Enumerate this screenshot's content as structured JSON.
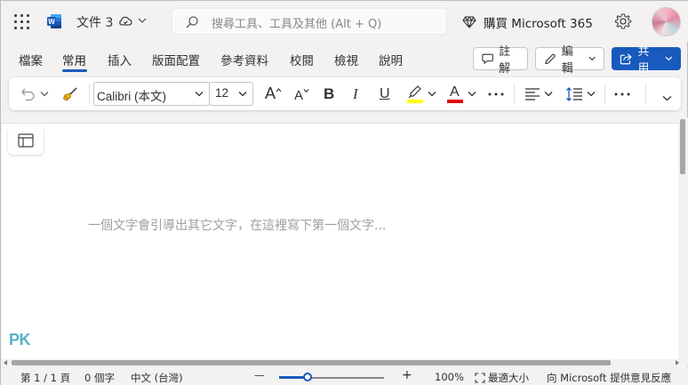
{
  "header": {
    "doc_title": "文件 3",
    "search_placeholder": "搜尋工具、工具及其他 (Alt + Q)",
    "buy_label": "購買 Microsoft 365"
  },
  "tabs": [
    {
      "label": "檔案"
    },
    {
      "label": "常用",
      "active": true
    },
    {
      "label": "插入"
    },
    {
      "label": "版面配置"
    },
    {
      "label": "參考資料"
    },
    {
      "label": "校閱"
    },
    {
      "label": "檢視"
    },
    {
      "label": "說明"
    }
  ],
  "tab_actions": {
    "comments_label": "註解",
    "editing_label": "編輯",
    "share_label": "共用"
  },
  "ribbon": {
    "font_name": "Calibri (本文)",
    "font_size": "12",
    "grow_font": "A",
    "shrink_font": "A",
    "bold": "B",
    "italic": "I",
    "underline": "U",
    "font_color": "A",
    "highlight_color": "#ffff00",
    "font_color_value": "#e00000"
  },
  "document": {
    "placeholder": "一個文字會引導出其它文字，在這裡寫下第一個文字..."
  },
  "watermark": {
    "logo_text": "PK"
  },
  "status": {
    "page": "第 1 / 1 頁",
    "words": "0 個字",
    "language": "中文 (台灣)",
    "zoom_minus": "—",
    "zoom_plus": "+",
    "zoom_level": "100%",
    "zoom_fraction": 0.27,
    "fit_label": "最適大小",
    "feedback": "向 Microsoft 提供意見反應"
  },
  "colors": {
    "accent": "#185abd",
    "app_bg": "#f3f2f1"
  }
}
